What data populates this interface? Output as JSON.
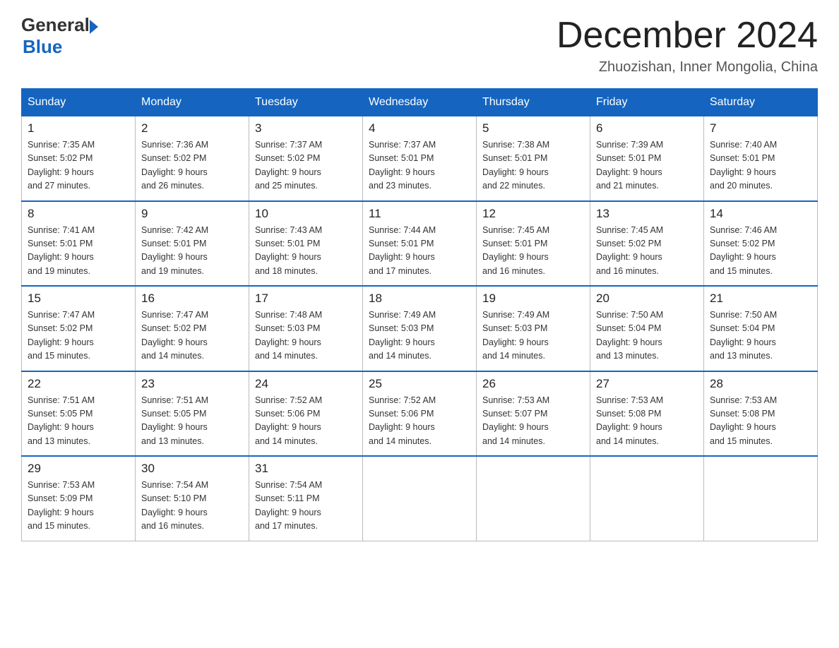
{
  "header": {
    "logo_general": "General",
    "logo_blue": "Blue",
    "title": "December 2024",
    "subtitle": "Zhuozishan, Inner Mongolia, China"
  },
  "weekdays": [
    "Sunday",
    "Monday",
    "Tuesday",
    "Wednesday",
    "Thursday",
    "Friday",
    "Saturday"
  ],
  "weeks": [
    [
      {
        "day": "1",
        "sunrise": "7:35 AM",
        "sunset": "5:02 PM",
        "daylight": "9 hours and 27 minutes."
      },
      {
        "day": "2",
        "sunrise": "7:36 AM",
        "sunset": "5:02 PM",
        "daylight": "9 hours and 26 minutes."
      },
      {
        "day": "3",
        "sunrise": "7:37 AM",
        "sunset": "5:02 PM",
        "daylight": "9 hours and 25 minutes."
      },
      {
        "day": "4",
        "sunrise": "7:37 AM",
        "sunset": "5:01 PM",
        "daylight": "9 hours and 23 minutes."
      },
      {
        "day": "5",
        "sunrise": "7:38 AM",
        "sunset": "5:01 PM",
        "daylight": "9 hours and 22 minutes."
      },
      {
        "day": "6",
        "sunrise": "7:39 AM",
        "sunset": "5:01 PM",
        "daylight": "9 hours and 21 minutes."
      },
      {
        "day": "7",
        "sunrise": "7:40 AM",
        "sunset": "5:01 PM",
        "daylight": "9 hours and 20 minutes."
      }
    ],
    [
      {
        "day": "8",
        "sunrise": "7:41 AM",
        "sunset": "5:01 PM",
        "daylight": "9 hours and 19 minutes."
      },
      {
        "day": "9",
        "sunrise": "7:42 AM",
        "sunset": "5:01 PM",
        "daylight": "9 hours and 19 minutes."
      },
      {
        "day": "10",
        "sunrise": "7:43 AM",
        "sunset": "5:01 PM",
        "daylight": "9 hours and 18 minutes."
      },
      {
        "day": "11",
        "sunrise": "7:44 AM",
        "sunset": "5:01 PM",
        "daylight": "9 hours and 17 minutes."
      },
      {
        "day": "12",
        "sunrise": "7:45 AM",
        "sunset": "5:01 PM",
        "daylight": "9 hours and 16 minutes."
      },
      {
        "day": "13",
        "sunrise": "7:45 AM",
        "sunset": "5:02 PM",
        "daylight": "9 hours and 16 minutes."
      },
      {
        "day": "14",
        "sunrise": "7:46 AM",
        "sunset": "5:02 PM",
        "daylight": "9 hours and 15 minutes."
      }
    ],
    [
      {
        "day": "15",
        "sunrise": "7:47 AM",
        "sunset": "5:02 PM",
        "daylight": "9 hours and 15 minutes."
      },
      {
        "day": "16",
        "sunrise": "7:47 AM",
        "sunset": "5:02 PM",
        "daylight": "9 hours and 14 minutes."
      },
      {
        "day": "17",
        "sunrise": "7:48 AM",
        "sunset": "5:03 PM",
        "daylight": "9 hours and 14 minutes."
      },
      {
        "day": "18",
        "sunrise": "7:49 AM",
        "sunset": "5:03 PM",
        "daylight": "9 hours and 14 minutes."
      },
      {
        "day": "19",
        "sunrise": "7:49 AM",
        "sunset": "5:03 PM",
        "daylight": "9 hours and 14 minutes."
      },
      {
        "day": "20",
        "sunrise": "7:50 AM",
        "sunset": "5:04 PM",
        "daylight": "9 hours and 13 minutes."
      },
      {
        "day": "21",
        "sunrise": "7:50 AM",
        "sunset": "5:04 PM",
        "daylight": "9 hours and 13 minutes."
      }
    ],
    [
      {
        "day": "22",
        "sunrise": "7:51 AM",
        "sunset": "5:05 PM",
        "daylight": "9 hours and 13 minutes."
      },
      {
        "day": "23",
        "sunrise": "7:51 AM",
        "sunset": "5:05 PM",
        "daylight": "9 hours and 13 minutes."
      },
      {
        "day": "24",
        "sunrise": "7:52 AM",
        "sunset": "5:06 PM",
        "daylight": "9 hours and 14 minutes."
      },
      {
        "day": "25",
        "sunrise": "7:52 AM",
        "sunset": "5:06 PM",
        "daylight": "9 hours and 14 minutes."
      },
      {
        "day": "26",
        "sunrise": "7:53 AM",
        "sunset": "5:07 PM",
        "daylight": "9 hours and 14 minutes."
      },
      {
        "day": "27",
        "sunrise": "7:53 AM",
        "sunset": "5:08 PM",
        "daylight": "9 hours and 14 minutes."
      },
      {
        "day": "28",
        "sunrise": "7:53 AM",
        "sunset": "5:08 PM",
        "daylight": "9 hours and 15 minutes."
      }
    ],
    [
      {
        "day": "29",
        "sunrise": "7:53 AM",
        "sunset": "5:09 PM",
        "daylight": "9 hours and 15 minutes."
      },
      {
        "day": "30",
        "sunrise": "7:54 AM",
        "sunset": "5:10 PM",
        "daylight": "9 hours and 16 minutes."
      },
      {
        "day": "31",
        "sunrise": "7:54 AM",
        "sunset": "5:11 PM",
        "daylight": "9 hours and 17 minutes."
      },
      null,
      null,
      null,
      null
    ]
  ],
  "labels": {
    "sunrise": "Sunrise: ",
    "sunset": "Sunset: ",
    "daylight": "Daylight: "
  }
}
